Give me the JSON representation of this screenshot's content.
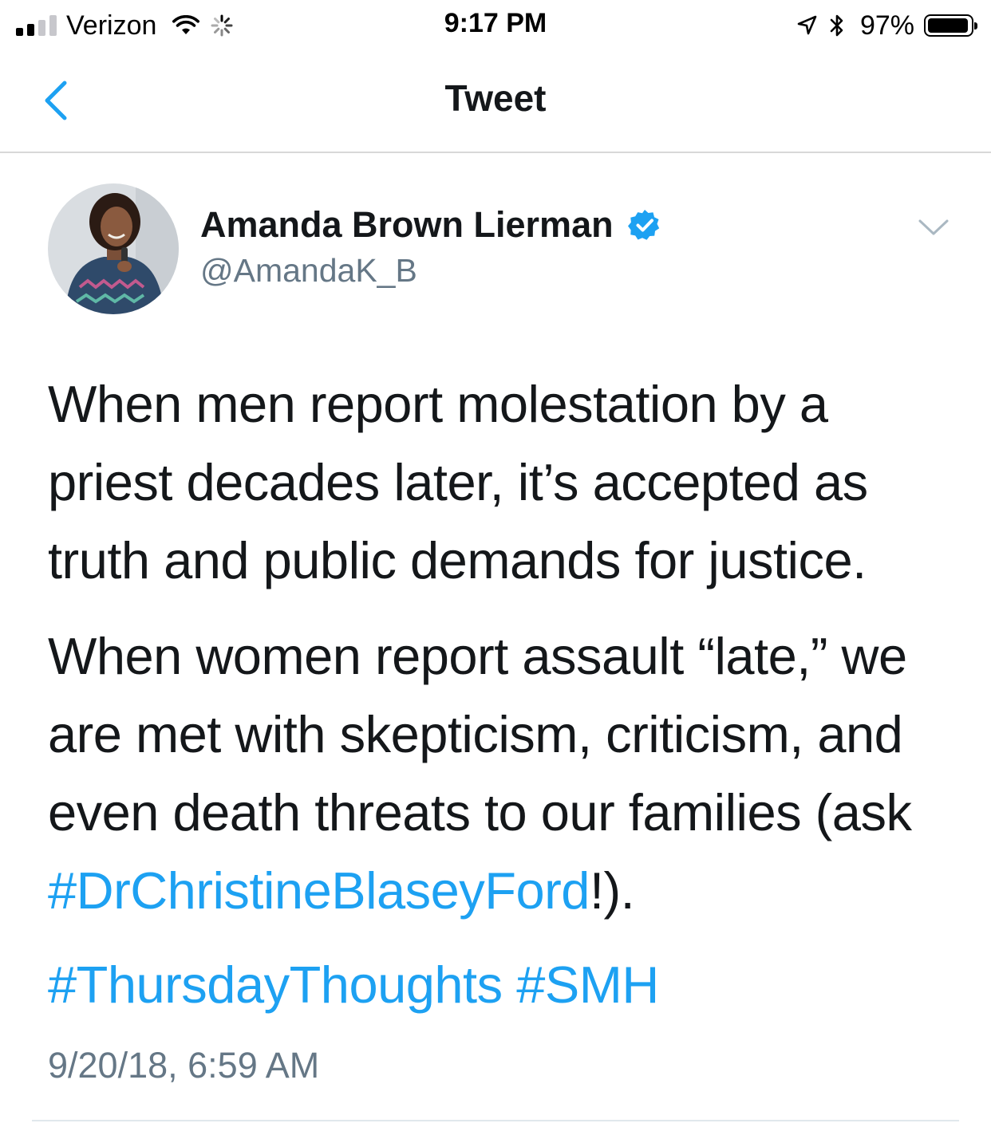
{
  "status_bar": {
    "carrier": "Verizon",
    "time": "9:17 PM",
    "battery_percent": "97%",
    "battery_level": 0.97,
    "signal_bars_filled": 2,
    "signal_bars_total": 4,
    "icons": [
      "signal-icon",
      "wifi-icon",
      "activity-spinner-icon",
      "location-arrow-icon",
      "bluetooth-icon",
      "battery-icon"
    ]
  },
  "nav": {
    "title": "Tweet",
    "back_icon": "chevron-left-icon"
  },
  "tweet": {
    "author_name": "Amanda Brown Lierman",
    "author_handle": "@AmandaK_B",
    "verified_icon": "verified-badge-icon",
    "menu_icon": "chevron-down-icon",
    "paragraph1": "When men report molestation by a priest decades later, it’s accepted as truth and public demands for justice.",
    "paragraph2_text": "When women report assault “late,” we are met with skepticism, criticism, and even death threats to our families (ask ",
    "paragraph2_hashtag": "#DrChristineBlaseyFord",
    "paragraph2_end": "!).",
    "hashtags": [
      "#ThursdayThoughts",
      "#SMH"
    ],
    "timestamp": "9/20/18, 6:59 AM"
  },
  "colors": {
    "link_blue": "#1da1f2",
    "text": "#14171a",
    "secondary_text": "#657786",
    "divider": "#d8d8d8"
  }
}
